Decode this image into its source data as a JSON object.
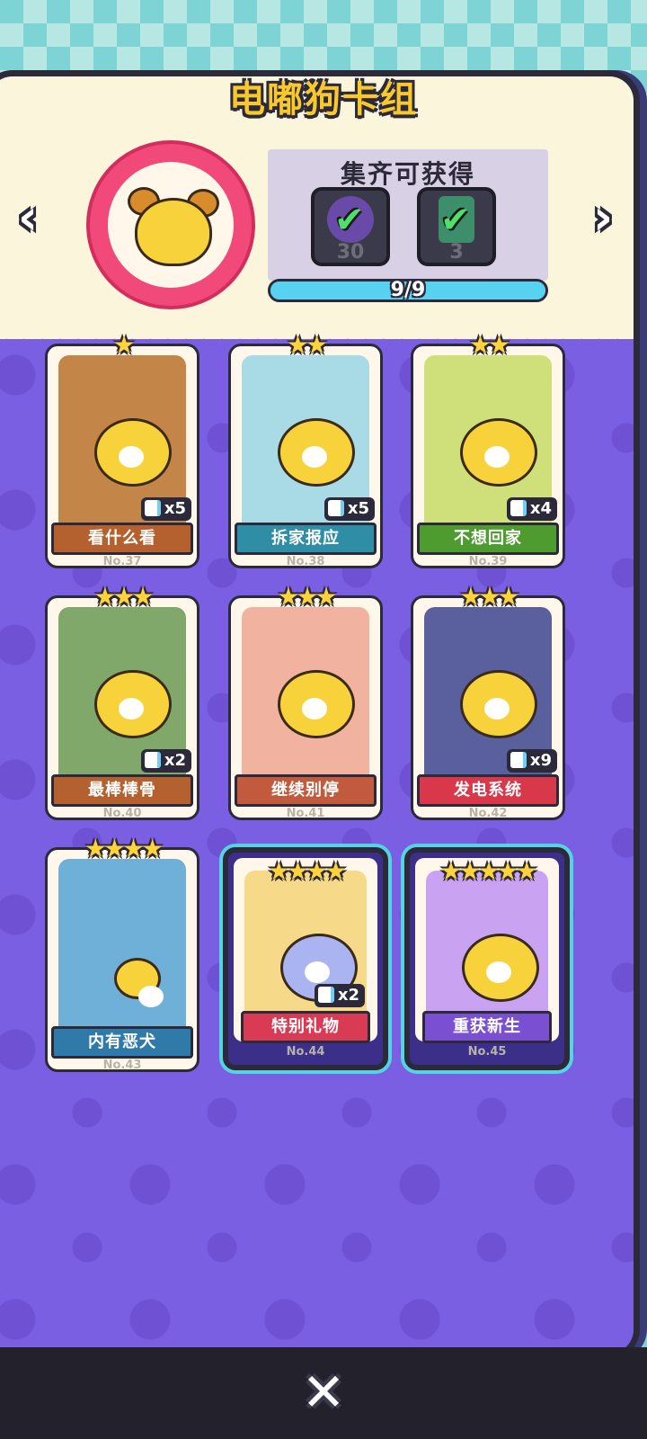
{
  "title": "电嘟狗卡组",
  "nav": {
    "prev": "‹",
    "next": "›"
  },
  "reward": {
    "title": "集齐可获得",
    "items": [
      {
        "icon": "avatar-frame-icon",
        "count": "30",
        "check": "✔"
      },
      {
        "icon": "card-back-icon",
        "count": "3",
        "check": "✔"
      }
    ]
  },
  "progress": {
    "text": "9/9",
    "collected": 9,
    "total": 9
  },
  "cards": [
    {
      "name": "看什么看",
      "no": "No.37",
      "stars": "★",
      "count": "x5",
      "ribbon_color": "#b4602f",
      "art_color": "#c48549"
    },
    {
      "name": "拆家报应",
      "no": "No.38",
      "stars": "★★",
      "count": "x5",
      "ribbon_color": "#2f8ea6",
      "art_color": "#a9dbe6"
    },
    {
      "name": "不想回家",
      "no": "No.39",
      "stars": "★★",
      "count": "x4",
      "ribbon_color": "#4e9b2f",
      "art_color": "#cfe07a"
    },
    {
      "name": "最棒棒骨",
      "no": "No.40",
      "stars": "★★★",
      "count": "x2",
      "ribbon_color": "#b4602f",
      "art_color": "#7fa86a"
    },
    {
      "name": "继续别停",
      "no": "No.41",
      "stars": "★★★",
      "count": "",
      "ribbon_color": "#c25a3e",
      "art_color": "#f2b2a0"
    },
    {
      "name": "发电系统",
      "no": "No.42",
      "stars": "★★★",
      "count": "x9",
      "ribbon_color": "#d9374a",
      "art_color": "#5a5f9e"
    },
    {
      "name": "内有恶犬",
      "no": "No.43",
      "stars": "★★★★",
      "count": "",
      "ribbon_color": "#2f7aa8",
      "art_color": "#6fb0d8"
    },
    {
      "name": "特别礼物",
      "no": "No.44",
      "stars": "★★★★",
      "count": "x2",
      "ribbon_color": "#d93a54",
      "art_color": "#f7d98a"
    },
    {
      "name": "重获新生",
      "no": "No.45",
      "stars": "★★★★★",
      "count": "",
      "ribbon_color": "#7a4fd2",
      "art_color": "#c9a3f2"
    }
  ],
  "close": "✕"
}
